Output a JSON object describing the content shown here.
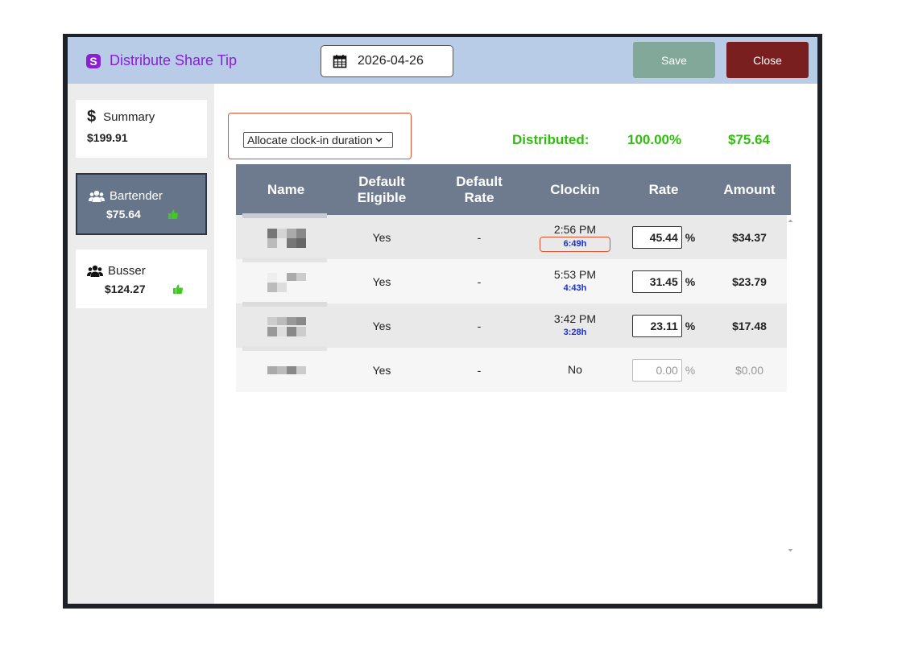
{
  "header": {
    "title": "Distribute Share Tip",
    "date": "2026-04-26",
    "save_label": "Save",
    "close_label": "Close"
  },
  "sidebar": {
    "items": [
      {
        "label": "Summary",
        "amount": "$199.91",
        "icon": "dollar-icon",
        "active": false
      },
      {
        "label": "Bartender",
        "amount": "$75.64",
        "icon": "users-icon",
        "active": true,
        "approved": true
      },
      {
        "label": "Busser",
        "amount": "$124.27",
        "icon": "users-icon",
        "active": false,
        "approved": true
      }
    ]
  },
  "allocation": {
    "selected": "Allocate clock-in duration"
  },
  "distributed": {
    "label": "Distributed:",
    "percent": "100.00%",
    "amount": "$75.64"
  },
  "table": {
    "columns": [
      "Name",
      "Default\nEligible",
      "Default\nRate",
      "Clockin",
      "Rate",
      "Amount"
    ],
    "rows": [
      {
        "eligible": "Yes",
        "default_rate": "-",
        "clockin": "2:56 PM",
        "duration": "6:49h",
        "rate": "45.44",
        "pct": "%",
        "amount": "$34.37"
      },
      {
        "eligible": "Yes",
        "default_rate": "-",
        "clockin": "5:53 PM",
        "duration": "4:43h",
        "rate": "31.45",
        "pct": "%",
        "amount": "$23.79"
      },
      {
        "eligible": "Yes",
        "default_rate": "-",
        "clockin": "3:42 PM",
        "duration": "3:28h",
        "rate": "23.11",
        "pct": "%",
        "amount": "$17.48"
      },
      {
        "eligible": "Yes",
        "default_rate": "-",
        "clockin": "No",
        "duration": "",
        "rate": "0.00",
        "pct": "%",
        "amount": "$0.00"
      }
    ]
  },
  "colors": {
    "header_bg": "#b8cce8",
    "title": "#8a1fd6",
    "distributed_green": "#33bb11",
    "table_header": "#6e7b8f",
    "duration_blue": "#1a2fd6"
  }
}
